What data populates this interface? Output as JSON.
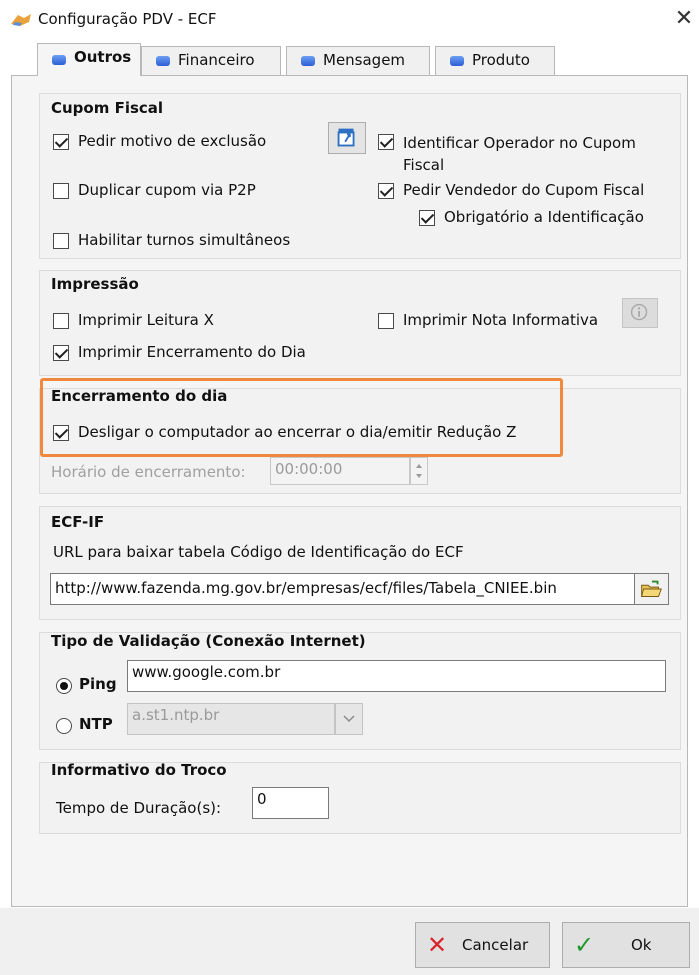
{
  "window": {
    "title": "Configuração PDV - ECF",
    "close_glyph": "✕"
  },
  "tabs": [
    {
      "label": "Outros",
      "active": true
    },
    {
      "label": "Financeiro",
      "active": false
    },
    {
      "label": "Mensagem",
      "active": false
    },
    {
      "label": "Produto",
      "active": false
    }
  ],
  "cupom_fiscal": {
    "title": "Cupom Fiscal",
    "pedir_motivo": {
      "label": "Pedir motivo de exclusão",
      "checked": true
    },
    "identificar_operador": {
      "label": "Identificar Operador no Cupom Fiscal",
      "checked": true
    },
    "duplicar_cupom": {
      "label": "Duplicar cupom via P2P",
      "checked": false
    },
    "pedir_vendedor": {
      "label": "Pedir Vendedor do Cupom Fiscal",
      "checked": true
    },
    "obrigatorio": {
      "label": "Obrigatório a Identificação",
      "checked": true
    },
    "turnos": {
      "label": "Habilitar turnos simultâneos",
      "checked": false
    }
  },
  "impressao": {
    "title": "Impressão",
    "leitura_x": {
      "label": "Imprimir Leitura X",
      "checked": false
    },
    "nota_informativa": {
      "label": "Imprimir Nota Informativa",
      "checked": false
    },
    "encerramento": {
      "label": "Imprimir Encerramento do Dia",
      "checked": true
    }
  },
  "encerramento_dia": {
    "title": "Encerramento do dia",
    "desligar": {
      "label": "Desligar o computador ao encerrar o dia/emitir Redução Z",
      "checked": true
    },
    "horario_label": "Horário de encerramento:",
    "horario_value": "00:00:00"
  },
  "ecf_if": {
    "title": "ECF-IF",
    "url_label": "URL para baixar tabela Código de Identificação do ECF",
    "url_value": "http://www.fazenda.mg.gov.br/empresas/ecf/files/Tabela_CNIEE.bin"
  },
  "validacao": {
    "title": "Tipo de Validação (Conexão Internet)",
    "ping_label": "Ping",
    "ping_value": "www.google.com.br",
    "ntp_label": "NTP",
    "ntp_value": "a.st1.ntp.br",
    "selected": "Ping"
  },
  "troco": {
    "title": "Informativo do Troco",
    "tempo_label": "Tempo de Duração(s):",
    "tempo_value": "0"
  },
  "footer": {
    "cancel_label": "Cancelar",
    "ok_label": "Ok"
  },
  "colors": {
    "highlight": "#f0883e",
    "tab_icon": "#2d5fd4",
    "cancel_icon": "#d9262c",
    "ok_icon": "#1f9a2e"
  }
}
